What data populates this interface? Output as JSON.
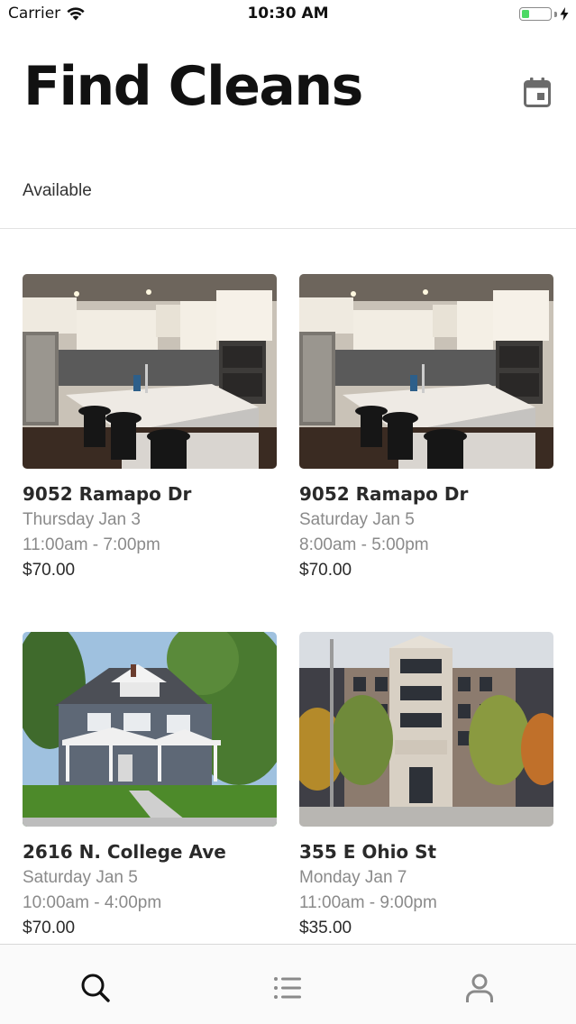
{
  "status_bar": {
    "carrier": "Carrier",
    "time": "10:30 AM",
    "battery_level": 0.25,
    "battery_color": "#4cd964"
  },
  "header": {
    "title": "Find Cleans",
    "calendar_icon": "calendar-icon"
  },
  "filter": {
    "label": "Available"
  },
  "listings": [
    {
      "address": "9052 Ramapo Dr",
      "date": "Thursday Jan 3",
      "time": "11:00am - 7:00pm",
      "price": "$70.00",
      "photo": "kitchen-photo"
    },
    {
      "address": "9052 Ramapo Dr",
      "date": "Saturday Jan 5",
      "time": "8:00am - 5:00pm",
      "price": "$70.00",
      "photo": "kitchen-photo"
    },
    {
      "address": "2616 N. College Ave",
      "date": "Saturday Jan 5",
      "time": "10:00am - 4:00pm",
      "price": "$70.00",
      "photo": "house-photo"
    },
    {
      "address": "355 E Ohio St",
      "date": "Monday Jan 7",
      "time": "11:00am - 9:00pm",
      "price": "$35.00",
      "photo": "apartment-building-photo"
    }
  ],
  "tab_bar": {
    "tabs": [
      {
        "icon": "search-icon",
        "active": true
      },
      {
        "icon": "list-icon",
        "active": false
      },
      {
        "icon": "profile-icon",
        "active": false
      }
    ],
    "active_color": "#111111",
    "inactive_color": "#8a8a8a"
  }
}
